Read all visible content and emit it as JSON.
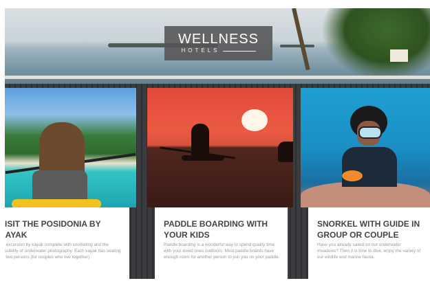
{
  "brand": {
    "line1": "WELLNESS",
    "line2": "HOTELS"
  },
  "cards": [
    {
      "title": "VISIT THE POSIDONIA BY KAYAK",
      "text": "An excursion by kayak complete with snorkeling and the possibility of underwater photography. Each kayak has seating for two persons (for couples who live together)"
    },
    {
      "title": "PADDLE BOARDING WITH YOUR KIDS",
      "text": "Paddle boarding is a wonderful way to spend quality time with your loved ones outdoors. Most paddle boards have enough room for another person to join you on your paddle."
    },
    {
      "title": "SNORKEL WITH GUIDE IN GROUP OR COUPLE",
      "text": "Have you already sailed on our underwater meadows? Then it is time to dive, enjoy the variety of our wildlife and marine fauna."
    }
  ]
}
